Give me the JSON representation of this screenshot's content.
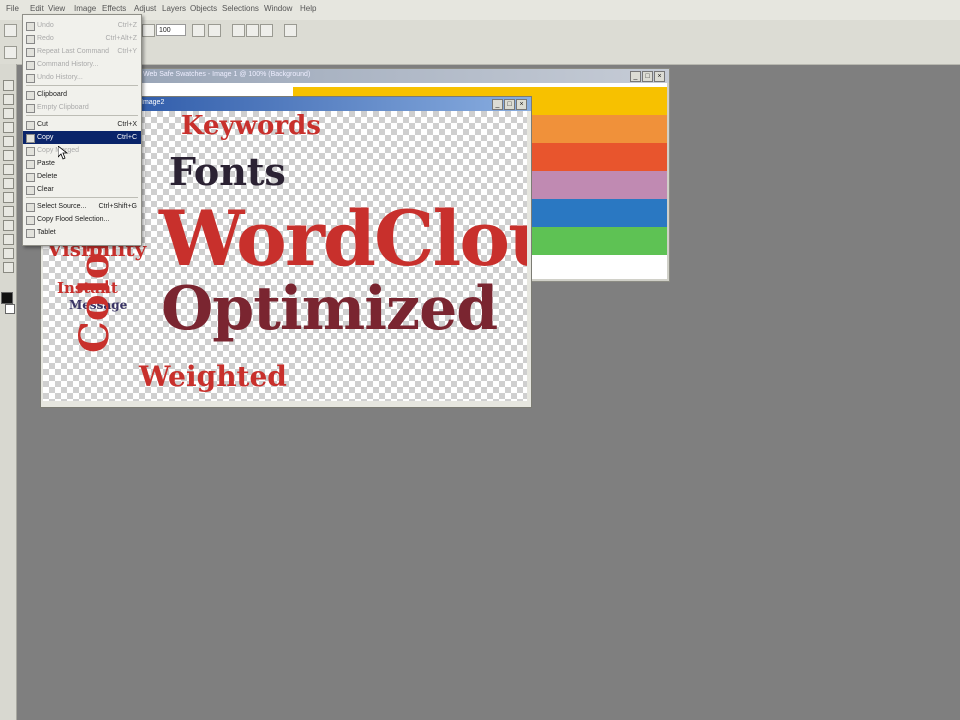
{
  "menubar": {
    "items": [
      "File",
      "Edit",
      "View",
      "Image",
      "Effects",
      "Adjust",
      "Layers",
      "Objects",
      "Selections",
      "Window",
      "Help"
    ]
  },
  "toolbar": {
    "zoom_value": "100"
  },
  "back_window": {
    "title": "Web Safe Swatches - Image 1 @ 100% (Background)",
    "stripes": [
      "#f7c100",
      "#f0913a",
      "#e8552d",
      "#c08ab2",
      "#2a78c2",
      "#5ec254"
    ]
  },
  "image_window": {
    "title": "Image2",
    "words": {
      "keywords": "Keywords",
      "fonts": "Fonts",
      "wordcloud": "WordCloud",
      "optimized": "Optimized",
      "colors": "Colors",
      "visibility": "Visibility",
      "instant": "Instant",
      "message": "Message",
      "weighted": "Weighted"
    },
    "colors": {
      "red": "#c8302c",
      "dark": "#2b2233",
      "maroon": "#7a2530",
      "navy": "#3a3466"
    }
  },
  "edit_menu": {
    "items": [
      {
        "label": "Undo",
        "shortcut": "Ctrl+Z",
        "disabled": true
      },
      {
        "label": "Redo",
        "shortcut": "Ctrl+Alt+Z",
        "disabled": true
      },
      {
        "label": "Repeat Last Command",
        "shortcut": "Ctrl+Y",
        "disabled": true
      },
      {
        "label": "Command History...",
        "shortcut": "",
        "disabled": true
      },
      {
        "label": "Undo History...",
        "shortcut": "",
        "disabled": true
      },
      {
        "label": "Clipboard",
        "shortcut": "",
        "disabled": false
      },
      {
        "label": "Empty Clipboard",
        "shortcut": "",
        "disabled": true
      },
      {
        "label": "Cut",
        "shortcut": "Ctrl+X",
        "disabled": false
      },
      {
        "label": "Copy",
        "shortcut": "Ctrl+C",
        "disabled": false,
        "highlighted": true
      },
      {
        "label": "Copy Merged",
        "shortcut": "",
        "disabled": true
      },
      {
        "label": "Paste",
        "shortcut": "",
        "disabled": false
      },
      {
        "label": "Delete",
        "shortcut": "",
        "disabled": false
      },
      {
        "label": "Clear",
        "shortcut": "",
        "disabled": false
      },
      {
        "label": "Select Source...",
        "shortcut": "Ctrl+Shift+G",
        "disabled": false
      },
      {
        "label": "Copy Flood Selection...",
        "shortcut": "",
        "disabled": false
      },
      {
        "label": "Tablet",
        "shortcut": "",
        "disabled": false
      }
    ]
  }
}
